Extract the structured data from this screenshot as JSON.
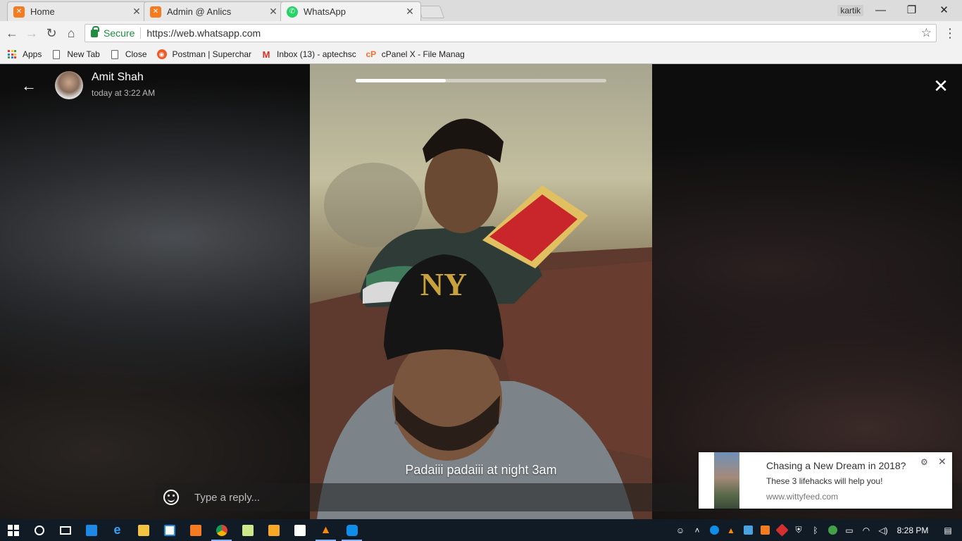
{
  "browser": {
    "tabs": [
      {
        "title": "Home",
        "icon": "xampp-icon"
      },
      {
        "title": "Admin @ Anlics",
        "icon": "xampp-icon"
      },
      {
        "title": "WhatsApp",
        "icon": "whatsapp-icon",
        "active": true
      }
    ],
    "tab_close": "✕",
    "profile_name": "kartik",
    "window_controls": {
      "minimize": "—",
      "restore": "❐",
      "close": "✕"
    },
    "nav": {
      "back": "←",
      "forward": "→",
      "reload": "↻",
      "home": "⌂"
    },
    "secure_label": "Secure",
    "url": "https://web.whatsapp.com",
    "star": "☆",
    "menu": "⋮",
    "bookmarks": [
      {
        "label": "Apps",
        "icon": "apps-grid-icon"
      },
      {
        "label": "New Tab",
        "icon": "page-icon"
      },
      {
        "label": "Close",
        "icon": "page-icon"
      },
      {
        "label": "Postman | Superchar",
        "icon": "postman-icon"
      },
      {
        "label": "Inbox (13) - aptechsc",
        "icon": "gmail-icon"
      },
      {
        "label": "cPanel X - File Manag",
        "icon": "cpanel-icon"
      }
    ]
  },
  "status_viewer": {
    "back": "←",
    "contact_name": "Amit Shah",
    "timestamp": "today at 3:22 AM",
    "close": "✕",
    "progress": 0.36,
    "caption": "Padaiii padaiii at night 3am",
    "reply_placeholder": "Type a reply..."
  },
  "notification": {
    "title": "Chasing a New Dream in 2018?",
    "body": "These 3 lifehacks will help you!",
    "url": "www.wittyfeed.com",
    "gear": "⚙",
    "close": "✕"
  },
  "taskbar": {
    "clock": "8:28 PM",
    "apps": [
      "start",
      "search",
      "task-view",
      "store-app",
      "edge",
      "file-explorer",
      "store",
      "xampp",
      "chrome",
      "notepad",
      "media-player",
      "mail",
      "vlc",
      "teamviewer"
    ]
  },
  "colors": {
    "secure_green": "#1e8e3e",
    "whatsapp_green": "#25d366",
    "xampp_orange": "#f47b20",
    "taskbar": "#101b26"
  }
}
